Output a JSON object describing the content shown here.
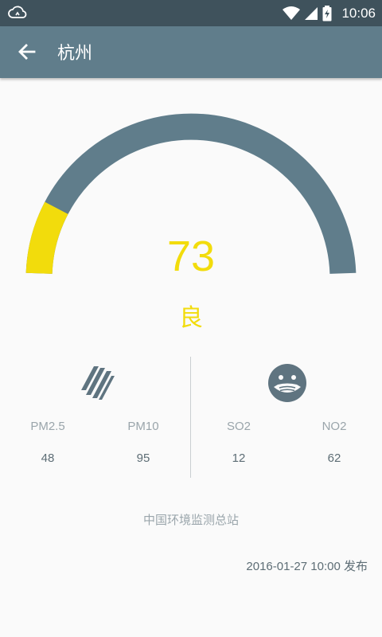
{
  "status_bar": {
    "time": "10:06"
  },
  "app_bar": {
    "title": "杭州"
  },
  "aqi": {
    "value": "73",
    "level": "良",
    "level_color": "#f2dc0c",
    "gauge_max": 500,
    "gauge_track_color": "#607d8b"
  },
  "pollutants": [
    {
      "name": "PM2.5",
      "value": "48"
    },
    {
      "name": "PM10",
      "value": "95"
    },
    {
      "name": "SO2",
      "value": "12"
    },
    {
      "name": "NO2",
      "value": "62"
    }
  ],
  "icons": {
    "left": "particulate-icon",
    "right": "mask-face-icon"
  },
  "source": "中国环境监测总站",
  "published": "2016-01-27 10:00 发布",
  "colors": {
    "status_bar": "#3f525c",
    "app_bar": "#607d8b",
    "accent": "#f2dc0c"
  }
}
